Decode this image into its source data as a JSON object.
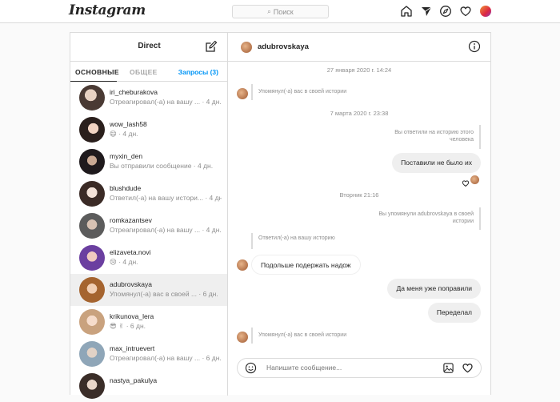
{
  "topbar": {
    "logo": "Instagram",
    "search_placeholder": "Поиск",
    "icons": [
      "home-icon",
      "direct-icon",
      "explore-icon",
      "heart-icon",
      "profile-avatar"
    ]
  },
  "inbox": {
    "title": "Direct",
    "tabs": {
      "primary": "ОСНОВНЫЕ",
      "general": "ОБЩЕЕ",
      "requests": "Запросы (3)"
    },
    "threads": [
      {
        "name": "iri_cheburakova",
        "preview": "Отреагировал(-а) на вашу ... · 4 дн."
      },
      {
        "name": "wow_lash58",
        "preview": "😄 · 4 дн."
      },
      {
        "name": "myxin_den",
        "preview": "Вы отправили сообщение · 4 дн."
      },
      {
        "name": "blushdude",
        "preview": "Ответил(-а) на вашу истори... · 4 дн."
      },
      {
        "name": "romkazantsev",
        "preview": "Отреагировал(-а) на вашу ... · 4 дн."
      },
      {
        "name": "elizaveta.novi",
        "preview": "😢 · 4 дн."
      },
      {
        "name": "adubrovskaya",
        "preview": "Упомянул(-а) вас в своей ... · 6 дн."
      },
      {
        "name": "krikunova_lera",
        "preview": "😎 ✌ · 6 дн."
      },
      {
        "name": "max_intruevert",
        "preview": "Отреагировал(-а) на вашу ... · 6 дн."
      },
      {
        "name": "nastya_pakulya",
        "preview": ""
      }
    ]
  },
  "chat": {
    "username": "adubrovskaya",
    "timestamps": [
      "27 января 2020 г. 14:24",
      "7 марта 2020 г. 23:38",
      "Вторник 21:16"
    ],
    "notes": {
      "mention1": "Упомянул(-а) вас в своей истории",
      "replied_story": "Вы ответили на историю этого человека",
      "you_mentioned": "Вы упомянули adubrovskaya в своей истории",
      "replied_to_your_story": "Ответил(-а) на вашу историю",
      "mention2": "Упомянул(-а) вас в своей истории"
    },
    "messages": {
      "out1": "Поставили не было их",
      "in1": "Подольше подержать надож",
      "out2": "Да меня уже поправили",
      "out3": "Переделал"
    },
    "composer_placeholder": "Напишите сообщение..."
  },
  "colors": {
    "accent": "#0095f6",
    "bubble_out": "#efefef",
    "border": "#dbdbdb"
  }
}
